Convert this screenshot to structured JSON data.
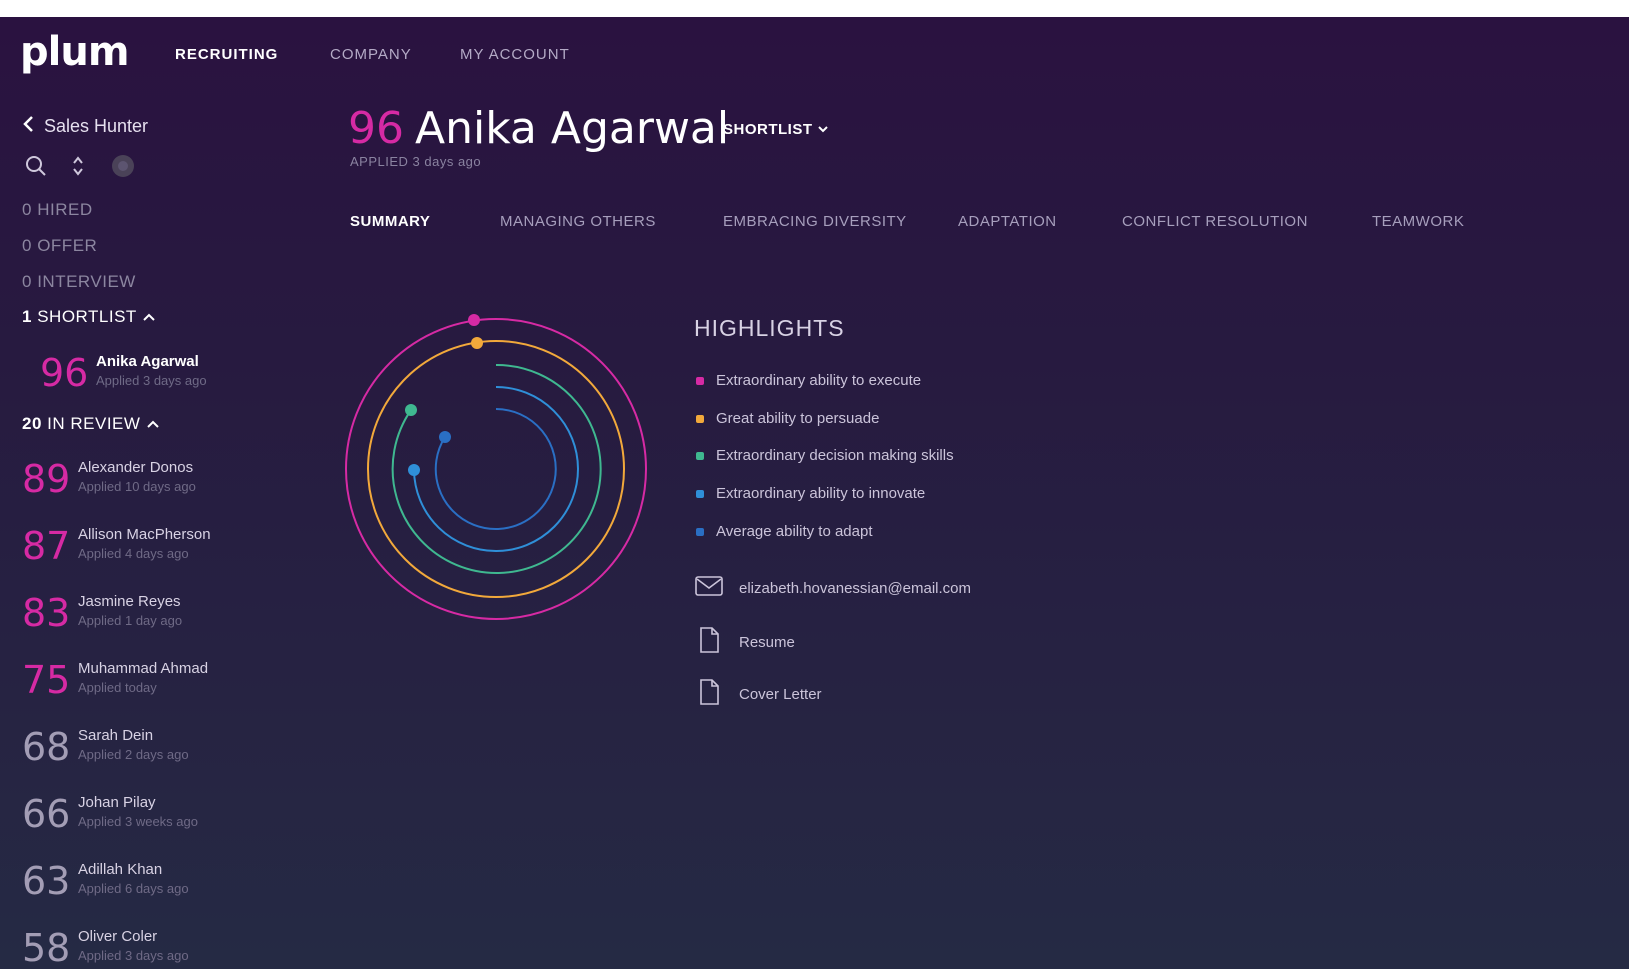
{
  "app": {
    "logo": "plum",
    "nav": [
      "RECRUITING",
      "COMPANY",
      "MY ACCOUNT"
    ],
    "active_nav": "RECRUITING"
  },
  "sidebar": {
    "back_label": "Sales Hunter",
    "stages": [
      {
        "count": "0",
        "label": "HIRED"
      },
      {
        "count": "0",
        "label": "OFFER"
      },
      {
        "count": "0",
        "label": "INTERVIEW"
      },
      {
        "count": "1",
        "label": "SHORTLIST",
        "open": true
      },
      {
        "count": "20",
        "label": "IN REVIEW",
        "open": true
      }
    ],
    "shortlist": [
      {
        "score": "96",
        "name": "Anika Agarwal",
        "applied": "Applied 3 days ago"
      }
    ],
    "in_review": [
      {
        "score": "89",
        "name": "Alexander Donos",
        "applied": "Applied 10 days ago"
      },
      {
        "score": "87",
        "name": "Allison MacPherson",
        "applied": "Applied 4 days ago"
      },
      {
        "score": "83",
        "name": "Jasmine Reyes",
        "applied": "Applied 1 day ago"
      },
      {
        "score": "75",
        "name": "Muhammad Ahmad",
        "applied": "Applied today"
      },
      {
        "score": "68",
        "name": "Sarah Dein",
        "applied": "Applied 2 days ago"
      },
      {
        "score": "66",
        "name": "Johan Pilay",
        "applied": "Applied 3 weeks ago"
      },
      {
        "score": "63",
        "name": "Adillah Khan",
        "applied": "Applied 6 days ago"
      },
      {
        "score": "58",
        "name": "Oliver Coler",
        "applied": "Applied 3 days ago"
      }
    ]
  },
  "candidate": {
    "score": "96",
    "name": "Anika Agarwal",
    "status": "SHORTLIST",
    "applied": "APPLIED 3 days ago"
  },
  "tabs": [
    "SUMMARY",
    "MANAGING OTHERS",
    "EMBRACING DIVERSITY",
    "ADAPTATION",
    "CONFLICT RESOLUTION",
    "TEAMWORK"
  ],
  "active_tab": "SUMMARY",
  "highlights": {
    "title": "HIGHLIGHTS",
    "items": [
      {
        "text": "Extraordinary ability to execute",
        "color": "#d62aa4"
      },
      {
        "text": "Great ability to persuade",
        "color": "#f2a93b"
      },
      {
        "text": "Extraordinary decision making skills",
        "color": "#3fb890"
      },
      {
        "text": "Extraordinary ability to innovate",
        "color": "#2f8fd8"
      },
      {
        "text": "Average ability to adapt",
        "color": "#2a6fc4"
      }
    ]
  },
  "contact": {
    "email": "elizabeth.hovanessian@email.com",
    "resume": "Resume",
    "cover_letter": "Cover Letter"
  },
  "colors": {
    "accent_pink": "#d62aa4",
    "accent_orange": "#f2a93b",
    "accent_green": "#3fb890",
    "accent_blue": "#2f8fd8",
    "accent_darkblue": "#2a6fc4"
  }
}
